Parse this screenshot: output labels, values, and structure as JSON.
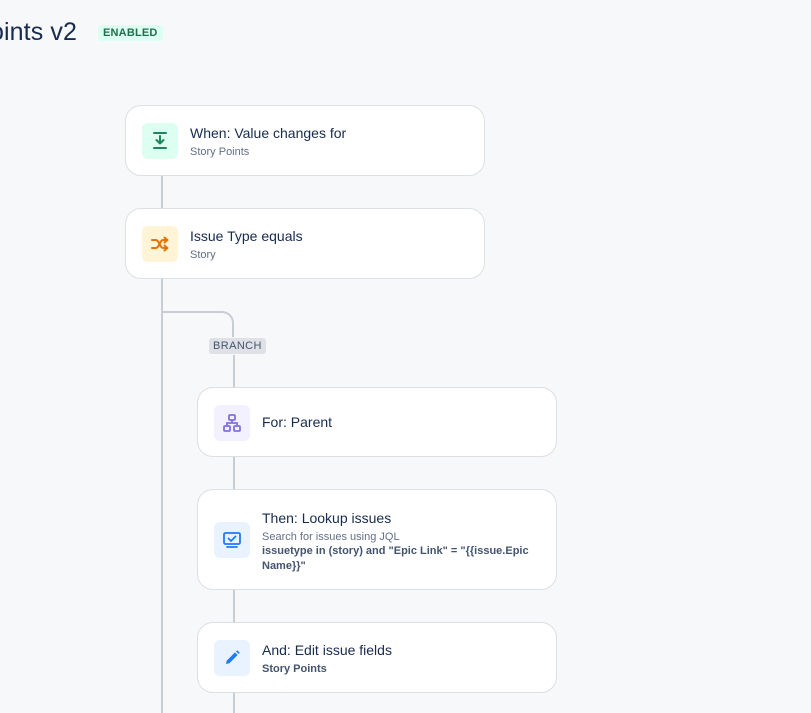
{
  "header": {
    "title": "oints v2",
    "status": "ENABLED"
  },
  "colors": {
    "trigger_icon_bg": "#dcfff1",
    "trigger_icon_fg": "#1f845a",
    "condition_icon_bg": "#fff4d6",
    "condition_icon_fg": "#e2740c",
    "branch_icon_bg": "#f3f0ff",
    "branch_icon_fg": "#8270db",
    "action_icon_bg": "#e9f2ff",
    "action_icon_fg": "#1d7afc"
  },
  "flow": {
    "trigger": {
      "icon": "value-change-icon",
      "title": "When: Value changes for",
      "subtitle": "Story Points"
    },
    "condition": {
      "icon": "shuffle-icon",
      "title": "Issue Type equals",
      "subtitle": "Story"
    },
    "branch": {
      "label": "BRANCH",
      "for_step": {
        "icon": "hierarchy-icon",
        "title": "For: Parent"
      },
      "lookup_step": {
        "icon": "lookup-icon",
        "title": "Then: Lookup issues",
        "subtitle": "Search for issues using JQL",
        "query": "issuetype in (story) and \"Epic Link\" = \"{{issue.Epic Name}}\""
      },
      "edit_step": {
        "icon": "edit-icon",
        "title": "And: Edit issue fields",
        "subtitle": "Story Points"
      }
    }
  }
}
